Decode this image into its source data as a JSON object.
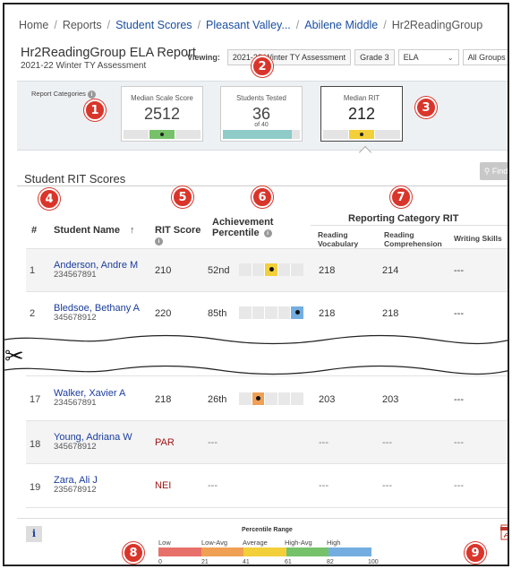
{
  "breadcrumb": {
    "home": "Home",
    "reports": "Reports",
    "student_scores": "Student Scores",
    "district": "Pleasant Valley...",
    "school": "Abilene Middle",
    "group": "Hr2ReadingGroup"
  },
  "header": {
    "title": "Hr2ReadingGroup ELA Report",
    "subtitle": "2021-22 Winter TY Assessment",
    "viewing_label": "Viewing:",
    "assessment": "2021-22 Winter TY Assessment",
    "grade": "Grade 3",
    "subject": "ELA",
    "groups": "All Groups"
  },
  "categories": {
    "label": "Report Categories",
    "cards": [
      {
        "title": "Median Scale Score",
        "value": "2512",
        "sub": ""
      },
      {
        "title": "Students Tested",
        "value": "36",
        "sub": "of 40",
        "fill_fraction": 0.9
      },
      {
        "title": "Median RIT",
        "value": "212",
        "sub": ""
      }
    ]
  },
  "section_title": "Student RIT Scores",
  "find_label": "Find",
  "table": {
    "headers": {
      "num": "#",
      "name": "Student Name",
      "rit": "RIT Score",
      "achievement": "Achievement",
      "percentile": "Percentile",
      "reporting": "Reporting Category RIT",
      "rv": "Reading Vocabulary",
      "rc": "Reading Comprehension",
      "ws": "Writing Skills"
    },
    "rows": [
      {
        "num": "1",
        "name": "Anderson, Andre M",
        "id": "234567891",
        "rit": "210",
        "pct": "52nd",
        "pct_value": 52,
        "rv": "218",
        "rc": "214",
        "ws": "---"
      },
      {
        "num": "2",
        "name": "Bledsoe, Bethany A",
        "id": "345678912",
        "rit": "220",
        "pct": "85th",
        "pct_value": 85,
        "rv": "218",
        "rc": "218",
        "ws": "---"
      },
      {
        "num": "17",
        "name": "Walker, Xavier A",
        "id": "234567891",
        "rit": "218",
        "pct": "26th",
        "pct_value": 26,
        "rv": "203",
        "rc": "203",
        "ws": "---"
      },
      {
        "num": "18",
        "name": "Young, Adriana W",
        "id": "345678912",
        "rit": "PAR",
        "pct": "---",
        "rv": "---",
        "rc": "---",
        "ws": "---"
      },
      {
        "num": "19",
        "name": "Zara, Ali J",
        "id": "235678912",
        "rit": "NEI",
        "pct": "---",
        "rv": "---",
        "rc": "---",
        "ws": "---"
      }
    ]
  },
  "legend": {
    "info_label": "i",
    "title": "Percentile Range",
    "ranges": [
      "Low",
      "Low-Avg",
      "Average",
      "High-Avg",
      "High"
    ],
    "ticks": [
      "0",
      "21",
      "41",
      "61",
      "82",
      "100"
    ],
    "colors": [
      "#e8706a",
      "#f0a055",
      "#f3cf3a",
      "#76c26a",
      "#74aee0"
    ]
  },
  "badges": [
    "1",
    "2",
    "3",
    "4",
    "5",
    "6",
    "7",
    "8",
    "9"
  ]
}
